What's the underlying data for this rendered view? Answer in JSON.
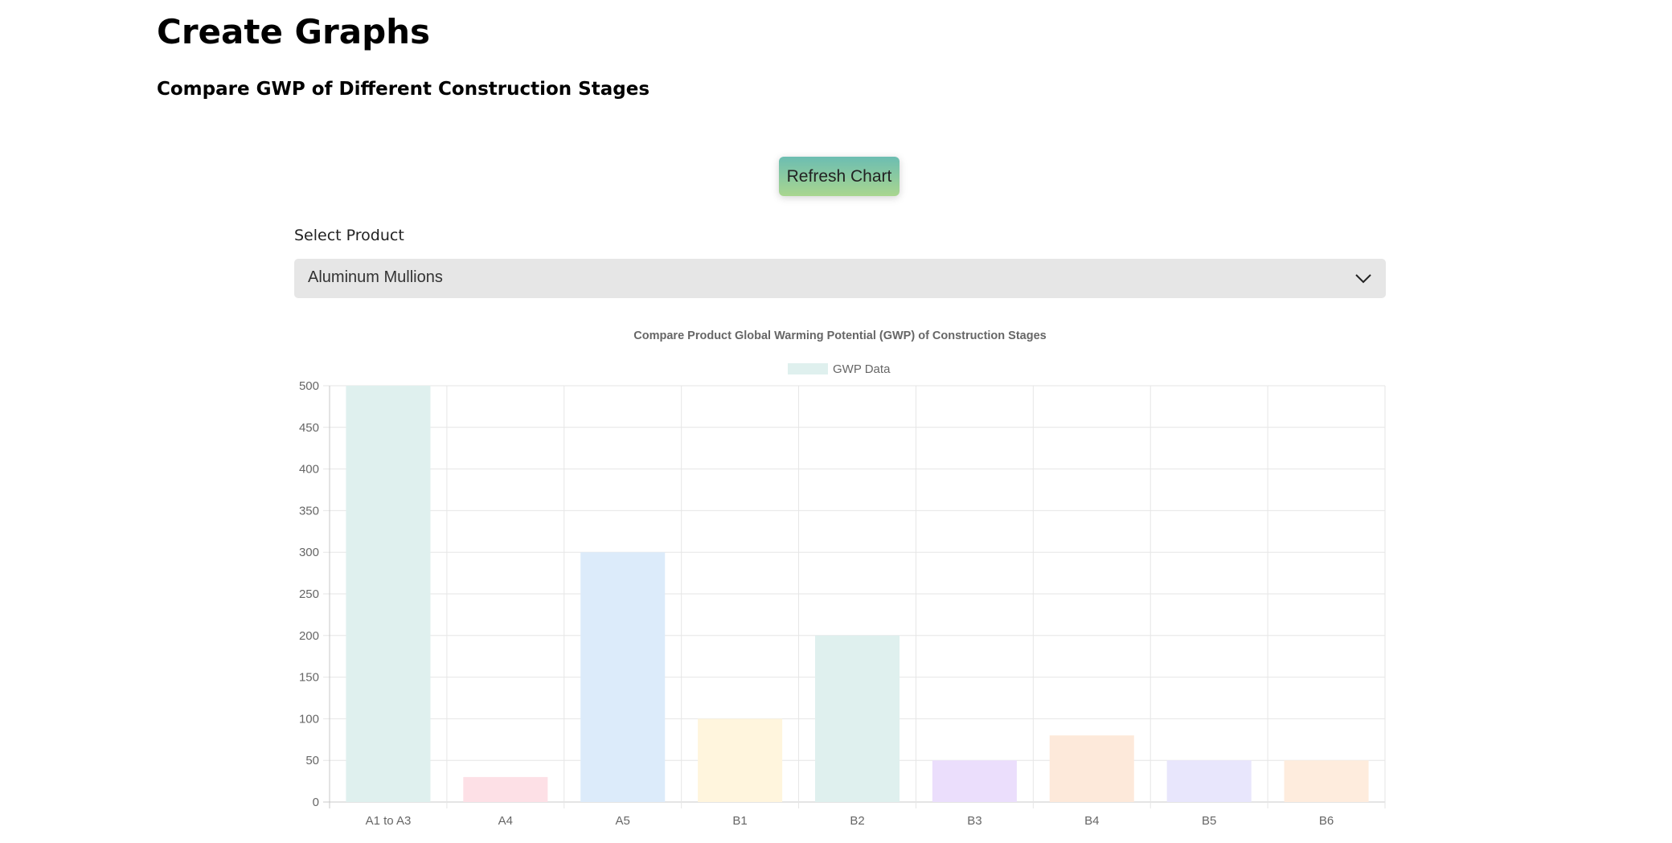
{
  "page": {
    "title": "Create Graphs",
    "subtitle": "Compare GWP of Different Construction Stages"
  },
  "controls": {
    "refresh_label": "Refresh Chart",
    "select_label": "Select Product",
    "selected_product": "Aluminum Mullions"
  },
  "chart_data": {
    "type": "bar",
    "title": "Compare Product Global Warming Potential (GWP) of Construction Stages",
    "legend": {
      "position": "top"
    },
    "grid": true,
    "categories": [
      "A1 to A3",
      "A4",
      "A5",
      "B1",
      "B2",
      "B3",
      "B4",
      "B5",
      "B6"
    ],
    "series": [
      {
        "name": "GWP Data",
        "values": [
          500,
          30,
          300,
          100,
          200,
          50,
          80,
          50,
          50
        ],
        "colors": [
          "#dff0ee",
          "#fde0e6",
          "#dcebfa",
          "#fff5dd",
          "#dff0ee",
          "#ebdefc",
          "#fde9da",
          "#e8e6fc",
          "#feecdd"
        ]
      }
    ],
    "legend_color": "#dff0ee",
    "yticks": [
      0,
      50,
      100,
      150,
      200,
      250,
      300,
      350,
      400,
      450,
      500
    ],
    "ylim": [
      0,
      500
    ],
    "xlabel": "",
    "ylabel": ""
  }
}
